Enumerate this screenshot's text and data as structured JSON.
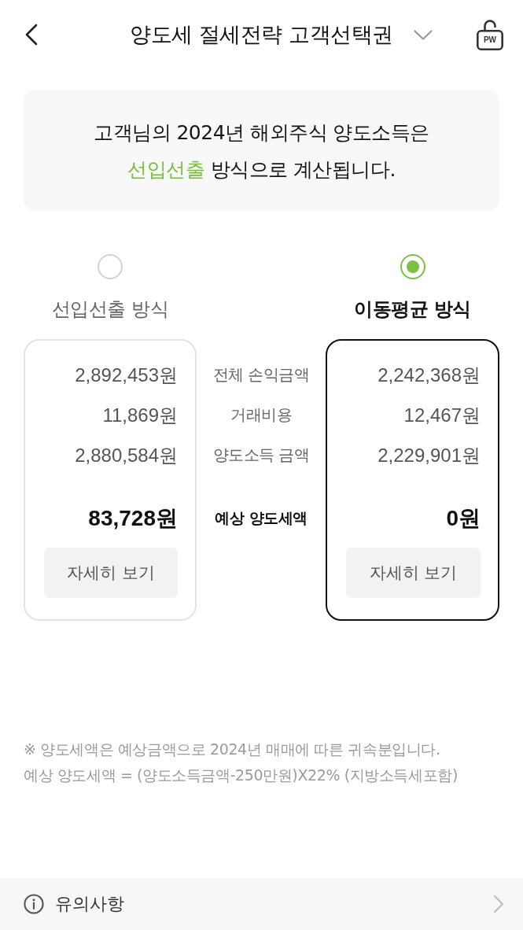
{
  "header": {
    "title": "양도세 절세전략 고객선택권",
    "lock_label": "PW"
  },
  "notice": {
    "text_before": "고객님의 2024년 해외주식 양도소득은",
    "highlight": "선입선출",
    "text_after": "방식으로 계산됩니다."
  },
  "row_labels": [
    "전체 손익금액",
    "거래비용",
    "양도소득 금액"
  ],
  "tax_label": "예상 양도세액",
  "methods": [
    {
      "name": "선입선출 방식",
      "selected": false,
      "values": [
        "2,892,453원",
        "11,869원",
        "2,880,584원"
      ],
      "tax": "83,728원",
      "button": "자세히 보기"
    },
    {
      "name": "이동평균 방식",
      "selected": true,
      "values": [
        "2,242,368원",
        "12,467원",
        "2,229,901원"
      ],
      "tax": "0원",
      "button": "자세히 보기"
    }
  ],
  "footnotes": [
    "※ 양도세액은 예상금액으로 2024년 매매에 따른 귀속분입니다.",
    "예상 양도세액 = (양도소득금액-250만원)X22% (지방소득세포함)"
  ],
  "footer": {
    "label": "유의사항"
  }
}
